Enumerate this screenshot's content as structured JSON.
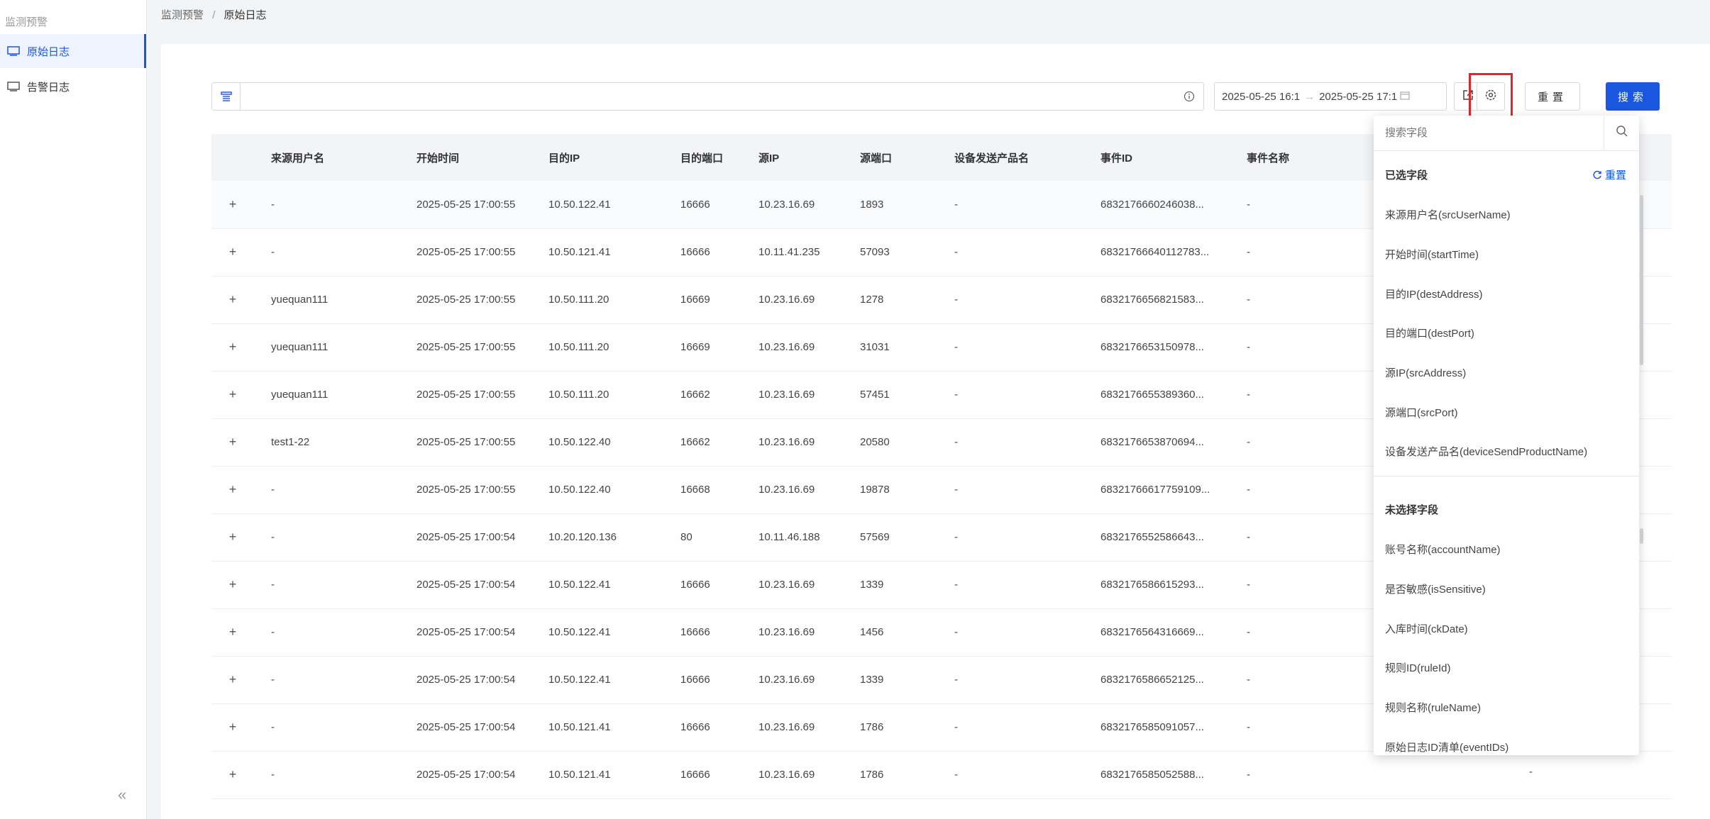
{
  "sidebar": {
    "group_label": "监测预警",
    "items": [
      {
        "label": "原始日志",
        "active": true
      },
      {
        "label": "告警日志",
        "active": false
      }
    ],
    "collapse_label": "«"
  },
  "breadcrumb": {
    "parent": "监测预警",
    "separator": "/",
    "current": "原始日志"
  },
  "toolbar": {
    "search_value": "",
    "date_start": "2025-05-25 16:1",
    "date_arrow": "→",
    "date_end": "2025-05-25 17:1",
    "reset_label": "重置",
    "search_label": "搜索"
  },
  "table": {
    "columns": [
      "来源用户名",
      "开始时间",
      "目的IP",
      "目的端口",
      "源IP",
      "源端口",
      "设备发送产品名",
      "事件ID",
      "事件名称"
    ],
    "rows": [
      [
        "-",
        "2025-05-25 17:00:55",
        "10.50.122.41",
        "16666",
        "10.23.16.69",
        "1893",
        "-",
        "6832176660246038...",
        "-"
      ],
      [
        "-",
        "2025-05-25 17:00:55",
        "10.50.121.41",
        "16666",
        "10.11.41.235",
        "57093",
        "-",
        "68321766640112783...",
        "-"
      ],
      [
        "yuequan111",
        "2025-05-25 17:00:55",
        "10.50.111.20",
        "16669",
        "10.23.16.69",
        "1278",
        "-",
        "6832176656821583...",
        "-"
      ],
      [
        "yuequan111",
        "2025-05-25 17:00:55",
        "10.50.111.20",
        "16669",
        "10.23.16.69",
        "31031",
        "-",
        "6832176653150978...",
        "-"
      ],
      [
        "yuequan111",
        "2025-05-25 17:00:55",
        "10.50.111.20",
        "16662",
        "10.23.16.69",
        "57451",
        "-",
        "6832176655389360...",
        "-"
      ],
      [
        "test1-22",
        "2025-05-25 17:00:55",
        "10.50.122.40",
        "16662",
        "10.23.16.69",
        "20580",
        "-",
        "6832176653870694...",
        "-"
      ],
      [
        "-",
        "2025-05-25 17:00:55",
        "10.50.122.40",
        "16668",
        "10.23.16.69",
        "19878",
        "-",
        "68321766617759109...",
        "-"
      ],
      [
        "-",
        "2025-05-25 17:00:54",
        "10.20.120.136",
        "80",
        "10.11.46.188",
        "57569",
        "-",
        "6832176552586643...",
        "-"
      ],
      [
        "-",
        "2025-05-25 17:00:54",
        "10.50.122.41",
        "16666",
        "10.23.16.69",
        "1339",
        "-",
        "6832176586615293...",
        "-"
      ],
      [
        "-",
        "2025-05-25 17:00:54",
        "10.50.122.41",
        "16666",
        "10.23.16.69",
        "1456",
        "-",
        "6832176564316669...",
        "-"
      ],
      [
        "-",
        "2025-05-25 17:00:54",
        "10.50.122.41",
        "16666",
        "10.23.16.69",
        "1339",
        "-",
        "6832176586652125...",
        "-"
      ],
      [
        "-",
        "2025-05-25 17:00:54",
        "10.50.121.41",
        "16666",
        "10.23.16.69",
        "1786",
        "-",
        "6832176585091057...",
        "-"
      ],
      [
        "-",
        "2025-05-25 17:00:54",
        "10.50.121.41",
        "16666",
        "10.23.16.69",
        "1786",
        "-",
        "6832176585052588...",
        "-"
      ]
    ],
    "last_row_trailing": "-"
  },
  "field_panel": {
    "search_placeholder": "搜索字段",
    "selected_title": "已选字段",
    "reset_label": "重置",
    "selected": [
      "来源用户名(srcUserName)",
      "开始时间(startTime)",
      "目的IP(destAddress)",
      "目的端口(destPort)",
      "源IP(srcAddress)",
      "源端口(srcPort)",
      "设备发送产品名(deviceSendProductName)"
    ],
    "unselected_title": "未选择字段",
    "unselected": [
      "账号名称(accountName)",
      "是否敏感(isSensitive)",
      "入库时间(ckDate)",
      "规则ID(ruleId)",
      "规则名称(ruleName)",
      "原始日志ID清单(eventIDs)"
    ]
  },
  "colors": {
    "accent": "#1a56e0",
    "highlight": "#e0262b"
  }
}
